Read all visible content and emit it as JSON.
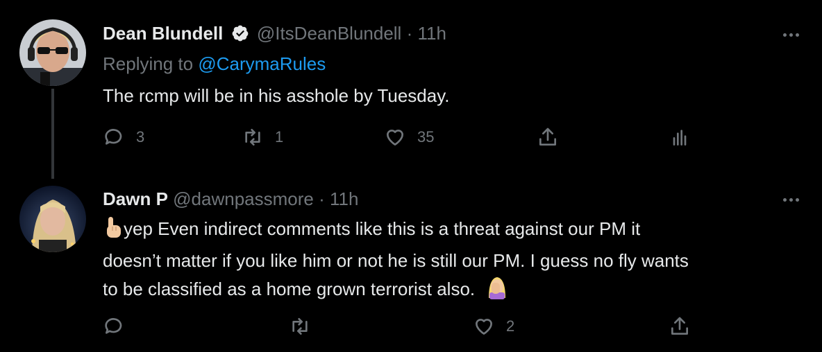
{
  "tweets": [
    {
      "name": "Dean Blundell",
      "verified": true,
      "handle": "@ItsDeanBlundell",
      "separator": "·",
      "time": "11h",
      "replying_prefix": "Replying to",
      "replying_to": "@CarymaRules",
      "text": "The rcmp will be in his asshole by Tuesday.",
      "replies": "3",
      "retweets": "1",
      "likes": "35"
    },
    {
      "name": "Dawn P",
      "handle": "@dawnpassmore",
      "separator": "·",
      "time": "11h",
      "text_line1": "yep   Even indirect comments like this is a threat against our PM it",
      "text_line2": "doesn’t matter if you like him or not he is still our PM. I guess no fly wants",
      "text_line3": "to be classified as a home grown terrorist also.",
      "replies": "",
      "retweets": "",
      "likes": "2"
    }
  ],
  "icons": [
    "verified-badge-icon",
    "more-icon",
    "reply-icon",
    "retweet-icon",
    "like-icon",
    "share-icon",
    "analytics-icon",
    "pointing-up-emoji",
    "facepalm-emoji"
  ]
}
